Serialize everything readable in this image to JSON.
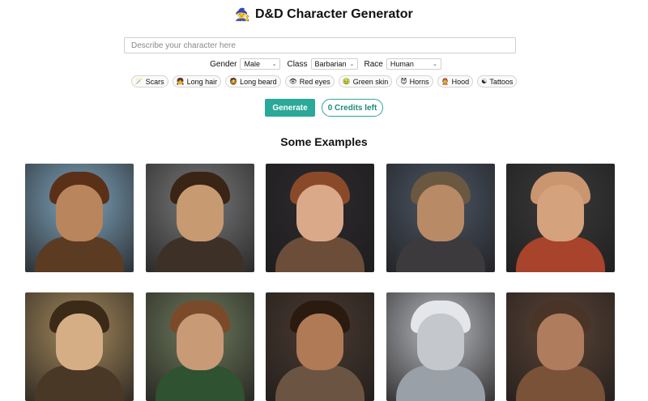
{
  "header": {
    "logo_glyph": "🧙",
    "title": "D&D Character Generator"
  },
  "form": {
    "description_placeholder": "Describe your character here",
    "gender_label": "Gender",
    "gender_value": "Male",
    "class_label": "Class",
    "class_value": "Barbarian",
    "race_label": "Race",
    "race_value": "Human"
  },
  "traits": [
    {
      "icon": "🪄",
      "label": "Scars"
    },
    {
      "icon": "👧",
      "label": "Long hair"
    },
    {
      "icon": "🧔",
      "label": "Long beard"
    },
    {
      "icon": "👁",
      "label": "Red eyes"
    },
    {
      "icon": "🤢",
      "label": "Green skin"
    },
    {
      "icon": "😈",
      "label": "Horns"
    },
    {
      "icon": "👲",
      "label": "Hood"
    },
    {
      "icon": "☯",
      "label": "Tattoos"
    }
  ],
  "actions": {
    "generate_label": "Generate",
    "credits_label": "0 Credits left"
  },
  "examples": {
    "heading": "Some Examples",
    "portraits": [
      {
        "name": "portrait-curly-hair-warrior",
        "bg": "#7fa6bf",
        "skin": "#b9855c",
        "hair": "#5a3019",
        "body": "#5b3b22"
      },
      {
        "name": "portrait-armored-man",
        "bg": "#7a7a7c",
        "skin": "#c89a72",
        "hair": "#3a2416",
        "body": "#3d3127"
      },
      {
        "name": "portrait-elf-woman-goggles",
        "bg": "#2c2a2e",
        "skin": "#d9a98a",
        "hair": "#8a4a2a",
        "body": "#6b4d39"
      },
      {
        "name": "portrait-crowned-bearded-man",
        "bg": "#4b5766",
        "skin": "#b98a66",
        "hair": "#6a5840",
        "body": "#3c3a3c"
      },
      {
        "name": "portrait-bald-monk",
        "bg": "#3a3a3a",
        "skin": "#d4a27c",
        "hair": "#c9966f",
        "body": "#a8432c"
      },
      {
        "name": "portrait-horned-helmet-woman",
        "bg": "#a58a5c",
        "skin": "#d6ae86",
        "hair": "#3b2a18",
        "body": "#4a3826"
      },
      {
        "name": "portrait-ranger-woman",
        "bg": "#6e7a5c",
        "skin": "#c99a76",
        "hair": "#7a4a2a",
        "body": "#2f5230"
      },
      {
        "name": "portrait-horned-barbarian",
        "bg": "#4a3a30",
        "skin": "#b07a56",
        "hair": "#2a1a10",
        "body": "#6b5542"
      },
      {
        "name": "portrait-white-haired-elf",
        "bg": "#b9bcc2",
        "skin": "#c4c8cc",
        "hair": "#e4e6ea",
        "body": "#9aa0a8"
      },
      {
        "name": "portrait-bald-bearded-dwarf",
        "bg": "#5a4436",
        "skin": "#b07c5e",
        "hair": "#4a3428",
        "body": "#7a5238"
      }
    ]
  }
}
